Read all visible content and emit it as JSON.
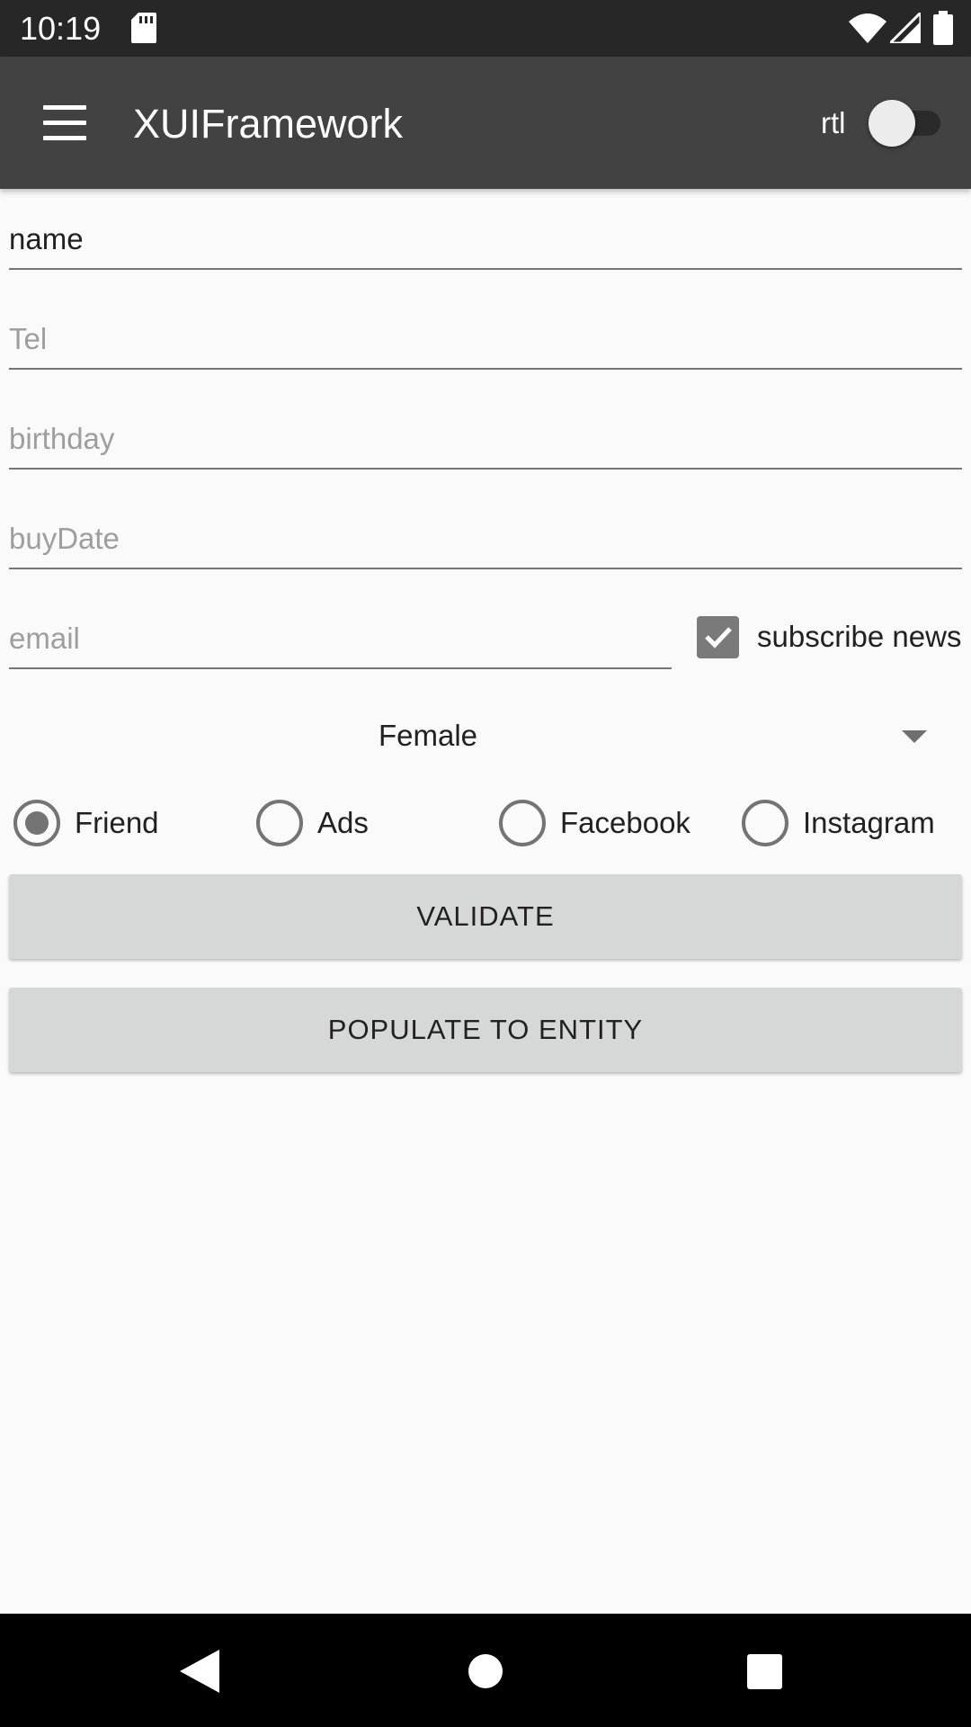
{
  "status_bar": {
    "time": "10:19",
    "icons": [
      "sd-card-icon",
      "wifi-icon",
      "signal-icon",
      "battery-icon"
    ]
  },
  "app_bar": {
    "menu_icon": "menu-icon",
    "title": "XUIFramework",
    "rtl_label": "rtl",
    "rtl_switch_on": false
  },
  "form": {
    "name": {
      "value": "name",
      "placeholder": ""
    },
    "tel": {
      "value": "",
      "placeholder": "Tel"
    },
    "birthday": {
      "value": "",
      "placeholder": "birthday"
    },
    "buy_date": {
      "value": "",
      "placeholder": "buyDate"
    },
    "email": {
      "value": "",
      "placeholder": "email"
    },
    "subscribe": {
      "label": "subscribe news",
      "checked": true
    },
    "gender_spinner": {
      "selected": "Female"
    },
    "source_radio": {
      "selected": "Friend",
      "options": [
        {
          "label": "Friend",
          "checked": true
        },
        {
          "label": "Ads",
          "checked": false
        },
        {
          "label": "Facebook",
          "checked": false
        },
        {
          "label": "Instagram",
          "checked": false
        }
      ]
    }
  },
  "buttons": {
    "validate": "VALIDATE",
    "populate": "POPULATE TO ENTITY"
  },
  "nav_bar": {
    "icons": [
      "back-icon",
      "home-icon",
      "recents-icon"
    ]
  },
  "colors": {
    "status_bar": "#272727",
    "app_bar": "#424242",
    "background": "#fafafa",
    "button": "#d6d7d7",
    "control_gray": "#747474"
  }
}
